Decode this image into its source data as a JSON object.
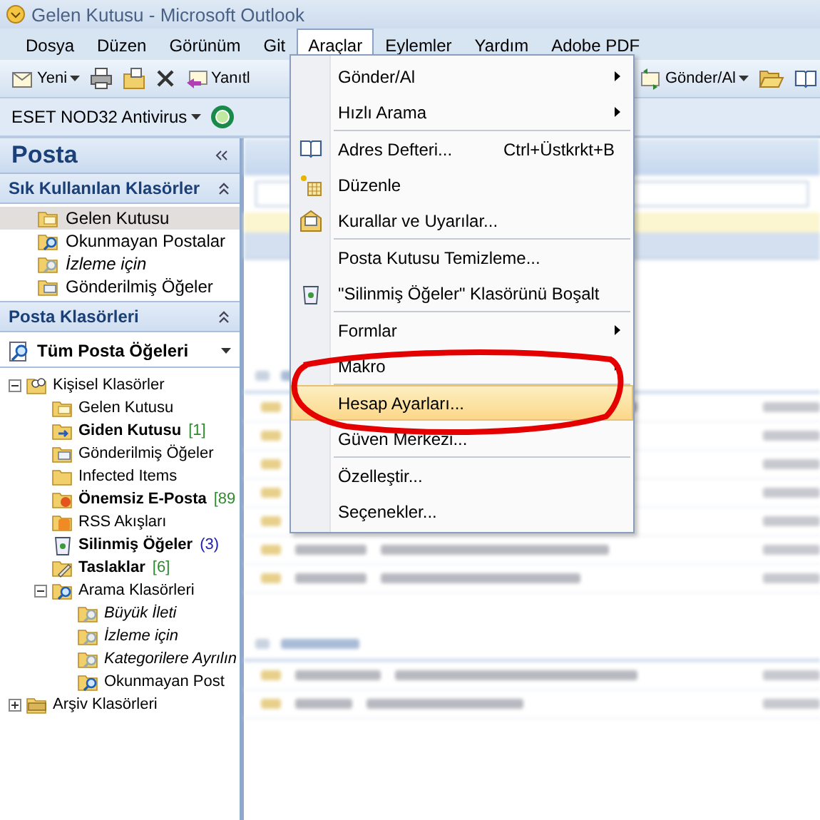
{
  "window": {
    "title": "Gelen Kutusu - Microsoft Outlook"
  },
  "menu_bar": [
    {
      "label": "Dosya",
      "selected": false
    },
    {
      "label": "Düzen",
      "selected": false
    },
    {
      "label": "Görünüm",
      "selected": false
    },
    {
      "label": "Git",
      "selected": false
    },
    {
      "label": "Araçlar",
      "selected": true
    },
    {
      "label": "Eylemler",
      "selected": false
    },
    {
      "label": "Yardım",
      "selected": false
    },
    {
      "label": "Adobe PDF",
      "selected": false
    }
  ],
  "toolbar": {
    "left": [
      {
        "kind": "new",
        "label": "Yeni",
        "dropdown": true
      },
      {
        "kind": "print"
      },
      {
        "kind": "move"
      },
      {
        "kind": "delete"
      },
      {
        "kind": "reply",
        "label": "Yanıtl"
      }
    ],
    "right": [
      {
        "kind": "send",
        "label": "Gönder/Al",
        "dropdown": true
      },
      {
        "kind": "folder"
      },
      {
        "kind": "book"
      }
    ]
  },
  "eset_toolbar": {
    "label": "ESET NOD32 Antivirus"
  },
  "sidebar": {
    "title": "Posta",
    "favorites": {
      "title": "Sık Kullanılan Klasörler",
      "items": [
        {
          "label": "Gelen Kutusu",
          "kind": "inbox",
          "selected": true,
          "italic": false
        },
        {
          "label": "Okunmayan Postalar",
          "kind": "search",
          "selected": false,
          "italic": false
        },
        {
          "label": "İzleme için",
          "kind": "search-grey",
          "selected": false,
          "italic": true
        },
        {
          "label": "Gönderilmiş Öğeler",
          "kind": "sent",
          "selected": false,
          "italic": false
        }
      ]
    },
    "folders": {
      "title": "Posta Klasörleri",
      "view": "Tüm Posta Öğeleri",
      "tree": [
        {
          "label": "Kişisel Klasörler",
          "kind": "personal",
          "expanded": true,
          "children": [
            {
              "label": "Gelen Kutusu",
              "kind": "inbox",
              "bold": false,
              "italic": false
            },
            {
              "label": "Giden Kutusu",
              "kind": "outbox",
              "bold": true,
              "italic": false,
              "count": {
                "text": "[1]",
                "color": "#2e8b2e"
              }
            },
            {
              "label": "Gönderilmiş Öğeler",
              "kind": "sent",
              "bold": false,
              "italic": false
            },
            {
              "label": "Infected Items",
              "kind": "folder",
              "bold": false,
              "italic": false
            },
            {
              "label": "Önemsiz E-Posta",
              "kind": "junk",
              "bold": true,
              "italic": false,
              "count": {
                "text": "[89",
                "color": "#2e8b2e"
              }
            },
            {
              "label": "RSS Akışları",
              "kind": "rss",
              "bold": false,
              "italic": false
            },
            {
              "label": "Silinmiş Öğeler",
              "kind": "trash",
              "bold": true,
              "italic": false,
              "count": {
                "text": "(3)",
                "color": "#2020b0"
              }
            },
            {
              "label": "Taslaklar",
              "kind": "drafts",
              "bold": true,
              "italic": false,
              "count": {
                "text": "[6]",
                "color": "#2e8b2e"
              }
            },
            {
              "label": "Arama Klasörleri",
              "kind": "search",
              "bold": false,
              "italic": false,
              "expanded": true,
              "children": [
                {
                  "label": "Büyük İleti",
                  "kind": "search-grey",
                  "bold": false,
                  "italic": true
                },
                {
                  "label": "İzleme için",
                  "kind": "search-grey",
                  "bold": false,
                  "italic": true
                },
                {
                  "label": "Kategorilere Ayrılın",
                  "kind": "search-grey",
                  "bold": false,
                  "italic": true
                },
                {
                  "label": "Okunmayan Post",
                  "kind": "search",
                  "bold": false,
                  "italic": false
                }
              ]
            }
          ]
        },
        {
          "label": "Arşiv Klasörleri",
          "kind": "archive",
          "expanded": false
        }
      ]
    }
  },
  "menu": {
    "groups": [
      [
        {
          "label": "Gönder/Al",
          "submenu": true,
          "highlighted": false
        },
        {
          "label": "Hızlı Arama",
          "submenu": true,
          "highlighted": false
        }
      ],
      [
        {
          "label": "Adres Defteri...",
          "kind": "book",
          "shortcut": "Ctrl+Üstkrkt+B",
          "submenu": false,
          "highlighted": false
        },
        {
          "label": "Düzenle",
          "kind": "organize",
          "submenu": false,
          "highlighted": false
        },
        {
          "label": "Kurallar ve Uyarılar...",
          "kind": "rules",
          "submenu": false,
          "highlighted": false
        }
      ],
      [
        {
          "label": "Posta Kutusu Temizleme...",
          "submenu": false,
          "highlighted": false
        },
        {
          "label": "\"Silinmiş Öğeler\" Klasörünü Boşalt",
          "kind": "trash",
          "submenu": false,
          "highlighted": false
        }
      ],
      [
        {
          "label": "Formlar",
          "submenu": true,
          "highlighted": false
        },
        {
          "label": "Makro",
          "submenu": true,
          "highlighted": false
        }
      ],
      [
        {
          "label": "Hesap Ayarları...",
          "submenu": false,
          "highlighted": true
        },
        {
          "label": "Güven Merkezi...",
          "submenu": false,
          "highlighted": false
        }
      ],
      [
        {
          "label": "Özelleştir...",
          "submenu": false,
          "highlighted": false
        },
        {
          "label": "Seçenekler...",
          "submenu": false,
          "highlighted": false
        }
      ]
    ]
  }
}
